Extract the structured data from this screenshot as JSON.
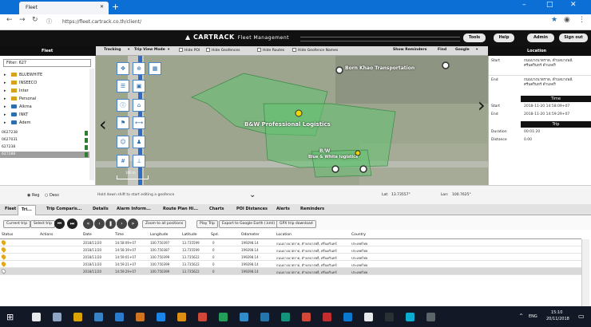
{
  "browser": {
    "tab_title": "Fleet",
    "url": "https://fleet.cartrack.co.th/client/",
    "min": "–",
    "max": "□",
    "close": "✕"
  },
  "header": {
    "logo_text": "CARTRACK",
    "logo_sub": "Fleet Management",
    "tools": "Tools",
    "help": "Help",
    "admin": "Admin",
    "signout": "Sign out"
  },
  "subbar": {
    "fleet": "Fleet",
    "location": "Location"
  },
  "toolbar": {
    "tracking": "Tracking",
    "trip_view": "Trip View Mode",
    "hide_poi": "Hide POI",
    "hide_geofences": "Hide Geofences",
    "hide_routes": "Hide Routes",
    "hide_geofence_names": "Hide Geofence Names",
    "show_reminders": "Show Reminders",
    "find": "Find",
    "google": "Google"
  },
  "left": {
    "filter": "Filter: 627",
    "items": [
      "BLUEWHITE",
      "INSEECO",
      "Inter",
      "Personal",
      "Alkma",
      "INKT",
      "Adem"
    ],
    "rows": [
      "0627238",
      "0627031",
      "627238",
      "627288"
    ]
  },
  "map": {
    "label_main": "B&W Professional Logistics",
    "label_transport": "Born Khao Transportation",
    "label_bw": "B/W",
    "label_bw2": "Blue & White logistics",
    "scale": "100 m",
    "ctl_icons": [
      "pan",
      "zoom",
      "layers",
      "legend",
      "nav",
      "info",
      "marker",
      "flag",
      "measure",
      "person"
    ]
  },
  "right": {
    "start_label": "Start",
    "start_addr": "ถนนบางนาตราด, ตำบลบางพลี, ศรีนครินทร์ ตำบลจริ",
    "end_label": "End",
    "end_addr": "ถนนบางนาตราด, ตำบลบางพลี, ศรีนครินทร์ ตำบลจริ",
    "time_head": "Time",
    "start_time_label": "Start",
    "start_time": "2018-11-20 14:58:09+07",
    "end_time_label": "End",
    "end_time": "2018-11-20 14:59:29+07",
    "trip_head": "Trip",
    "duration_label": "Duration",
    "duration": "00:01:20",
    "distance_label": "Distance",
    "distance": "0.00"
  },
  "statusbar": {
    "reg": "Reg",
    "desc": "Desc",
    "hint": "Hold down shift to start editing a geofence",
    "lat_label": "Lat:",
    "lat": "13.73557°",
    "lon_label": "Lon:",
    "lon": "100.7625°"
  },
  "lowertabs": [
    "Fleet",
    "Tri...",
    "Trip Comparis...",
    "Details",
    "Alarm Inform...",
    "Route Plan Hi...",
    "Charts",
    "POI Distances",
    "Alerts",
    "Reminders"
  ],
  "lowertool": {
    "current_trip": "Current trip",
    "select_trip": "Select trip",
    "zoom_all": "Zoom to all positions",
    "play": "Play Trip",
    "export_kml": "Export to Google Earth (.kml)",
    "gpx": "GPX trip download"
  },
  "table": {
    "headers": [
      "Status",
      "Actions",
      "Date",
      "Time",
      "Longitude",
      "Latitude",
      "Spd.",
      "Odometer",
      "Location",
      "Country"
    ],
    "rows": [
      [
        "2018/11/20",
        "14:58:09+07",
        "100.750397",
        "13.735599",
        "0",
        "199298.14",
        "ถนนบางนาตราด, ตำบลบางพลี, ศรีนครินทร์",
        "ประเทศไทย"
      ],
      [
        "2018/11/20",
        "14:58:39+07",
        "100.750387",
        "13.735599",
        "0",
        "199298.14",
        "ถนนบางนาตราด, ตำบลบางพลี, ศรีนครินทร์",
        "ประเทศไทย"
      ],
      [
        "2018/11/20",
        "14:59:01+07",
        "100.750399",
        "13.735622",
        "0",
        "199298.14",
        "ถนนบางนาตราด, ตำบลบางพลี, ศรีนครินทร์",
        "ประเทศไทย"
      ],
      [
        "2018/11/20",
        "14:59:21+07",
        "100.750399",
        "13.735622",
        "0",
        "199298.14",
        "ถนนบางนาตราด, ตำบลบางพลี, ศรีนครินทร์",
        "ประเทศไทย"
      ],
      [
        "2018/11/20",
        "14:59:29+07",
        "100.750399",
        "13.735622",
        "0",
        "199298.14",
        "ถนนบางนาตราด, ตำบลบางพลี, ศรีนครินทร์",
        "ประเทศไทย"
      ]
    ]
  },
  "taskbar": {
    "lang": "ENG",
    "time": "15:10",
    "date": "20/11/2018",
    "icon_colors": [
      "#ffffff",
      "#9fb4d6",
      "#f0b400",
      "#3b8ed6",
      "#2e86de",
      "#e67e22",
      "#1e90ff",
      "#f39c12",
      "#e74c3c",
      "#27ae60",
      "#3498db",
      "#2980b9",
      "#16a085",
      "#e74c3c",
      "#d63031",
      "#0984e3",
      "#ffffff",
      "#2d3436",
      "#0abde3",
      "#636e72"
    ]
  }
}
